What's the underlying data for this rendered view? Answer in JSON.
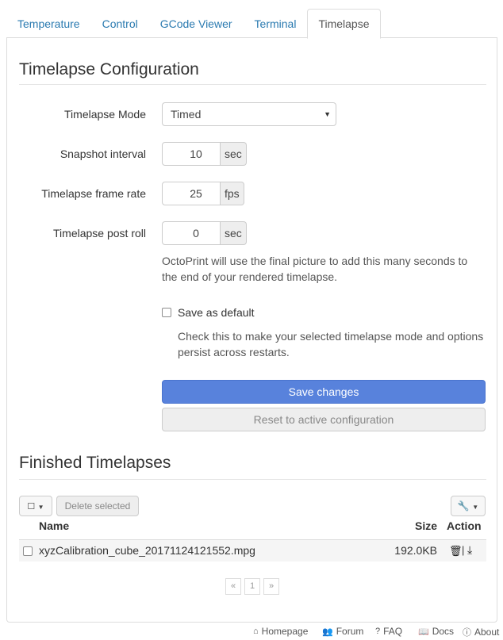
{
  "tabs": [
    {
      "label": "Temperature",
      "active": false
    },
    {
      "label": "Control",
      "active": false
    },
    {
      "label": "GCode Viewer",
      "active": false
    },
    {
      "label": "Terminal",
      "active": false
    },
    {
      "label": "Timelapse",
      "active": true
    }
  ],
  "config": {
    "title": "Timelapse Configuration",
    "mode_label": "Timelapse Mode",
    "mode_value": "Timed",
    "interval_label": "Snapshot interval",
    "interval_value": "10",
    "interval_unit": "sec",
    "framerate_label": "Timelapse frame rate",
    "framerate_value": "25",
    "framerate_unit": "fps",
    "postroll_label": "Timelapse post roll",
    "postroll_value": "0",
    "postroll_unit": "sec",
    "postroll_help": "OctoPrint will use the final picture to add this many seconds to the end of your rendered timelapse.",
    "save_default_label": "Save as default",
    "save_default_checked": false,
    "save_default_help": "Check this to make your selected timelapse mode and options persist across restarts.",
    "save_button": "Save changes",
    "reset_button": "Reset to active configuration"
  },
  "finished": {
    "title": "Finished Timelapses",
    "delete_selected": "Delete selected",
    "columns": {
      "name": "Name",
      "size": "Size",
      "action": "Action"
    },
    "rows": [
      {
        "name": "xyzCalibration_cube_20171124121552.mpg",
        "size": "192.0KB"
      }
    ],
    "pager": {
      "prev": "«",
      "page": "1",
      "next": "»"
    }
  },
  "footer": {
    "homepage": "Homepage",
    "forum": "Forum",
    "faq": "FAQ",
    "docs": "Docs",
    "about": "About"
  },
  "colors": {
    "link": "#2a7ab0",
    "primary": "#5882dc"
  }
}
